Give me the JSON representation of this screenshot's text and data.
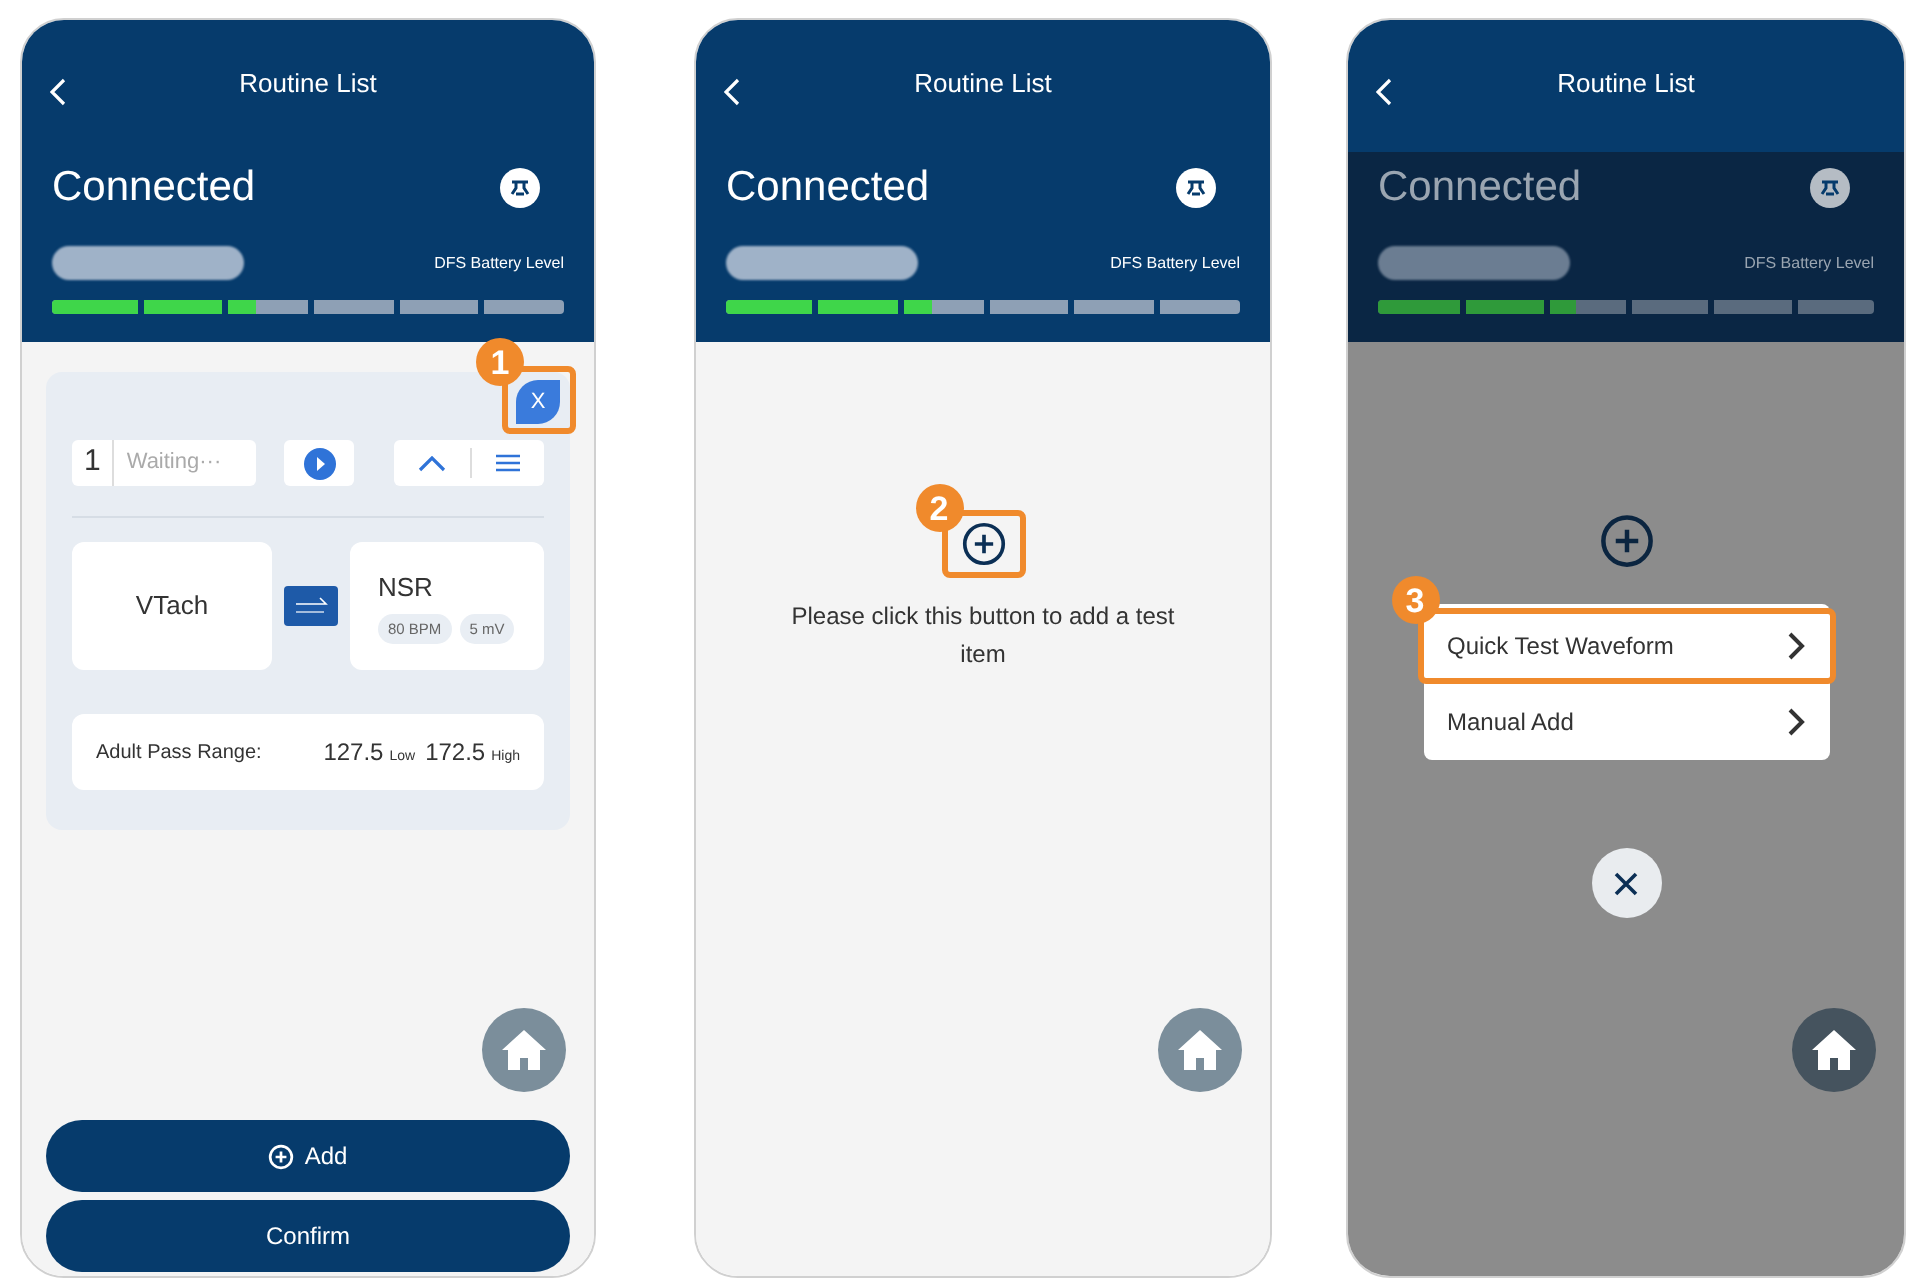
{
  "screens": [
    {
      "kind": "list",
      "dimmed": false,
      "title": "Routine List",
      "status": "Connected",
      "battery_label": "DFS Battery Level",
      "battery": {
        "level": 0.4
      },
      "step": "1",
      "item": {
        "close": "X",
        "index": "1",
        "state": "Waiting···",
        "source": "VTach",
        "target": "NSR",
        "tags": [
          "80 BPM",
          "5 mV"
        ],
        "range_label": "Adult Pass Range:",
        "low": "127.5",
        "low_unit": "Low",
        "high": "172.5",
        "high_unit": "High"
      },
      "buttons": [
        {
          "kind": "add",
          "label": "Add"
        },
        {
          "kind": "confirm",
          "label": "Confirm"
        }
      ]
    },
    {
      "kind": "empty",
      "dimmed": false,
      "title": "Routine List",
      "status": "Connected",
      "battery_label": "DFS Battery Level",
      "battery": {
        "level": 0.4
      },
      "step": "2",
      "hint": "Please click this button to add a test item"
    },
    {
      "kind": "menu",
      "dimmed": true,
      "title": "Routine List",
      "status": "Connected",
      "battery_label": "DFS Battery Level",
      "battery": {
        "level": 0.4
      },
      "step": "3",
      "menu": [
        {
          "label": "Quick Test Waveform",
          "selected": true
        },
        {
          "label": "Manual Add",
          "selected": false
        }
      ]
    }
  ]
}
